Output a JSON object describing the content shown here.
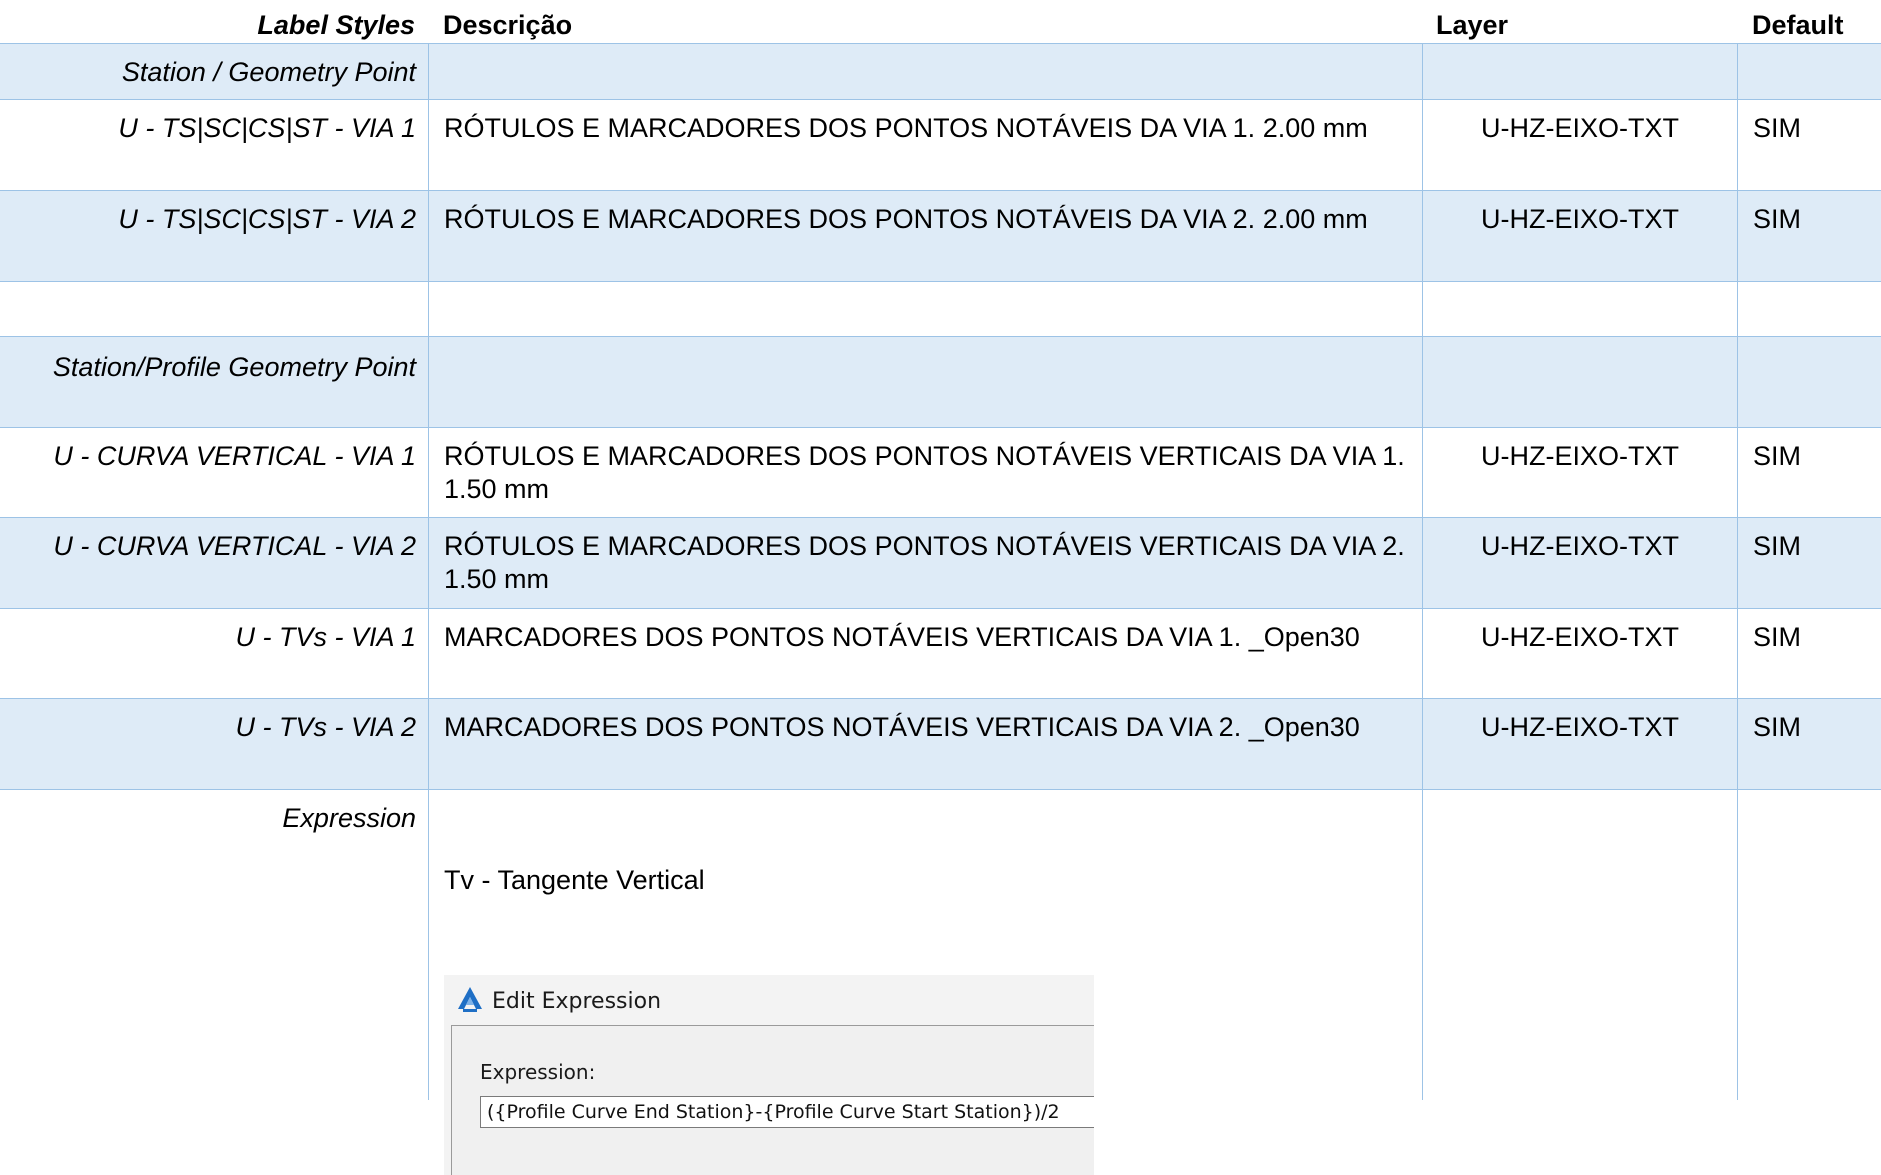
{
  "header": {
    "label_styles": "Label Styles",
    "descricao": "Descrição",
    "layer": "Layer",
    "default": "Default"
  },
  "rows": [
    {
      "label": "Station / Geometry Point",
      "desc": "",
      "layer": "",
      "default": ""
    },
    {
      "label": "U - TS|SC|CS|ST - VIA 1",
      "desc": "RÓTULOS E MARCADORES DOS PONTOS NOTÁVEIS DA VIA 1. 2.00 mm",
      "layer": "U-HZ-EIXO-TXT",
      "default": "SIM"
    },
    {
      "label": "U - TS|SC|CS|ST - VIA 2",
      "desc": "RÓTULOS E MARCADORES DOS PONTOS NOTÁVEIS DA VIA 2. 2.00 mm",
      "layer": "U-HZ-EIXO-TXT",
      "default": "SIM"
    },
    {
      "label": "",
      "desc": "",
      "layer": "",
      "default": ""
    },
    {
      "label": "Station/Profile Geometry Point",
      "desc": "",
      "layer": "",
      "default": ""
    },
    {
      "label": "U - CURVA VERTICAL - VIA 1",
      "desc": "RÓTULOS E MARCADORES DOS PONTOS NOTÁVEIS VERTICAIS DA VIA 1. 1.50 mm",
      "layer": "U-HZ-EIXO-TXT",
      "default": "SIM"
    },
    {
      "label": "U - CURVA VERTICAL - VIA 2",
      "desc": "RÓTULOS E MARCADORES DOS PONTOS NOTÁVEIS VERTICAIS DA VIA 2. 1.50 mm",
      "layer": "U-HZ-EIXO-TXT",
      "default": "SIM"
    },
    {
      "label": "U - TVs - VIA 1",
      "desc": "MARCADORES DOS PONTOS NOTÁVEIS VERTICAIS DA VIA 1. _Open30",
      "layer": "U-HZ-EIXO-TXT",
      "default": "SIM"
    },
    {
      "label": "U - TVs - VIA 2",
      "desc": "MARCADORES DOS PONTOS NOTÁVEIS VERTICAIS DA VIA 2. _Open30",
      "layer": "U-HZ-EIXO-TXT",
      "default": "SIM"
    }
  ],
  "expression_row": {
    "label": "Expression",
    "text": "Tv - Tangente Vertical",
    "dialog": {
      "title": "Edit Expression",
      "field_label": "Expression:",
      "field_value": "({Profile Curve End Station}-{Profile Curve Start Station})/2",
      "icon": "civil3d-app-icon"
    }
  },
  "colors": {
    "border": "#9dc3e6",
    "shade": "#deebf7"
  }
}
